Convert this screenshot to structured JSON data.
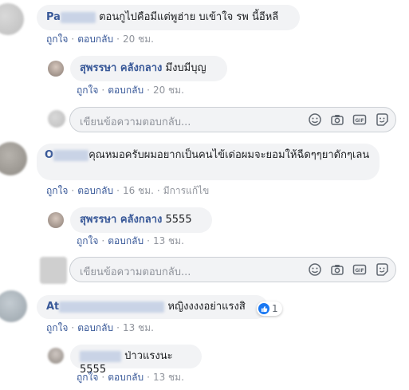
{
  "actions": {
    "like": "ถูกใจ",
    "reply": "ตอบกลับ",
    "separator": "·"
  },
  "reply_placeholder": "เขียนข้อความตอบกลับ...",
  "comments": [
    {
      "author_visible": "Pa",
      "text": "ตอนกูไปคือมีแต่พูฮ่าย บเข้าใจ รพ นี้อีหลี",
      "time": "20 ชม."
    },
    {
      "author": "สุพรรษา คลังกลาง",
      "text": "มึงบมีบุญ",
      "time": "20 ชม."
    },
    {
      "author_visible": "O",
      "text": "คุณหมอครับผมอยากเป็นคนไข้เด่อผมจะยอมให้ฉีดๆๆยาดักๆเลน",
      "time": "16 ชม.",
      "edited": "มีการแก้ไข"
    },
    {
      "author": "สุพรรษา คลังกลาง",
      "text": "5555",
      "time": "13 ชม."
    },
    {
      "author_visible": "At",
      "text": "หญิงงงงอย่าแรงสิ",
      "time": "13 ชม.",
      "likes": "1"
    },
    {
      "text": "ป่าวแรงนะ 5555",
      "time": "13 ชม."
    }
  ],
  "icons": [
    "smiley-icon",
    "camera-icon",
    "gif-icon",
    "sticker-icon",
    "like-icon"
  ]
}
